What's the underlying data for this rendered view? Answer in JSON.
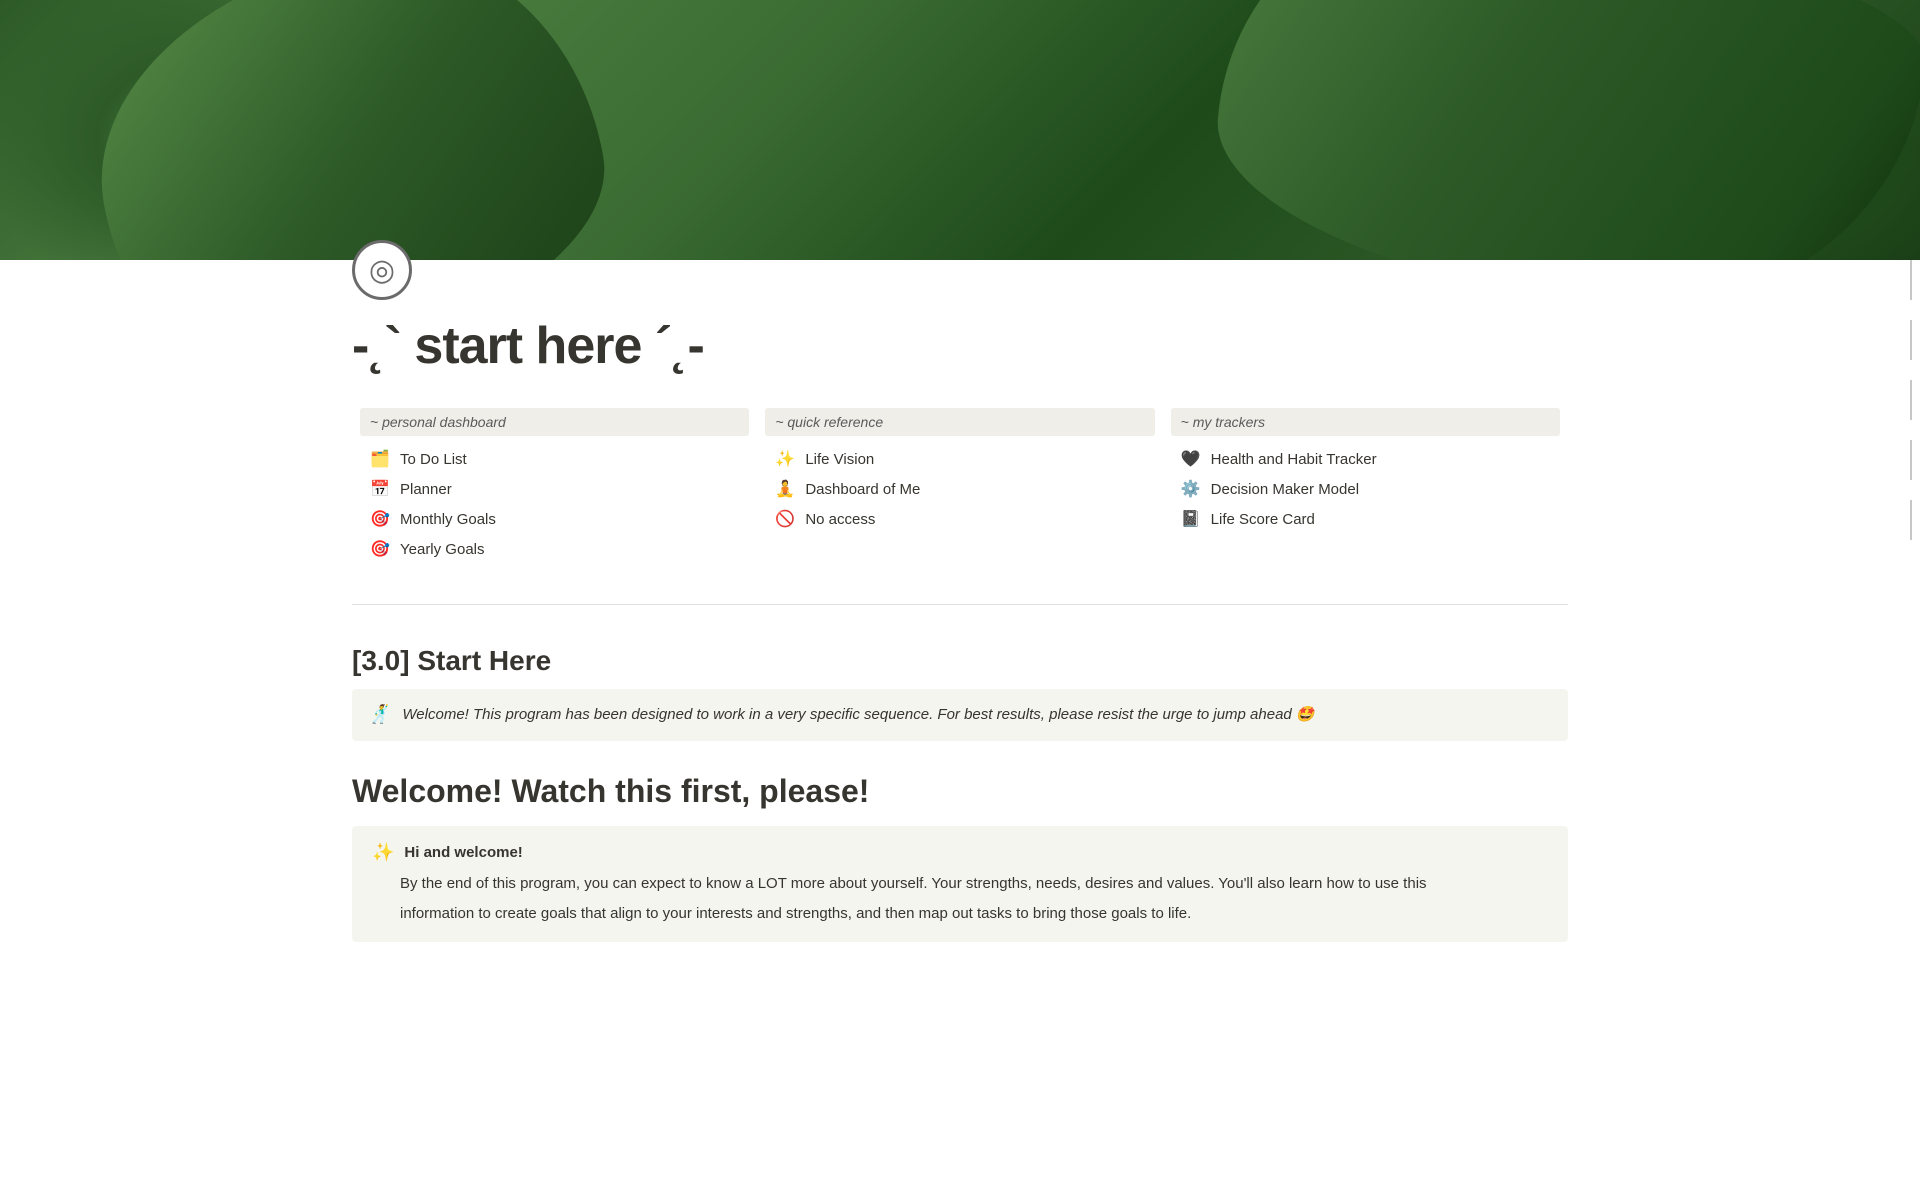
{
  "hero": {
    "alt": "Monstera leaf background"
  },
  "page": {
    "icon_label": "◎",
    "title": "-˛` start here ´˛-"
  },
  "columns": [
    {
      "header": "~ personal dashboard",
      "items": [
        {
          "icon": "🗂️",
          "text": "To Do List"
        },
        {
          "icon": "📅",
          "text": "Planner"
        },
        {
          "icon": "🎯",
          "text": "Monthly Goals"
        },
        {
          "icon": "🎯",
          "text": "Yearly Goals"
        }
      ]
    },
    {
      "header": "~ quick reference",
      "items": [
        {
          "icon": "✨",
          "text": "Life Vision"
        },
        {
          "icon": "🧘",
          "text": "Dashboard of Me"
        },
        {
          "icon": "🚫",
          "text": "No access"
        }
      ]
    },
    {
      "header": "~ my trackers",
      "items": [
        {
          "icon": "🖤",
          "text": "Health and Habit Tracker"
        },
        {
          "icon": "⚙️",
          "text": "Decision Maker Model"
        },
        {
          "icon": "📓",
          "text": "Life Score Card"
        }
      ]
    }
  ],
  "start_here": {
    "heading": "[3.0] Start Here",
    "callout_icon": "🕺",
    "callout_text": "Welcome!  This program has been designed to work in a very specific sequence.  For best results, please resist the urge to jump ahead 🤩"
  },
  "welcome": {
    "heading": "Welcome! Watch this first, please!",
    "callout_icon": "✨",
    "callout_title": "Hi and welcome!",
    "callout_body_1": "By the end of this program, you can expect to know a LOT more about yourself.  Your strengths, needs, desires and values.  You'll also learn how to use this",
    "callout_body_2": "information to create goals that align to your interests and strengths, and then map out tasks to bring those goals to life."
  }
}
